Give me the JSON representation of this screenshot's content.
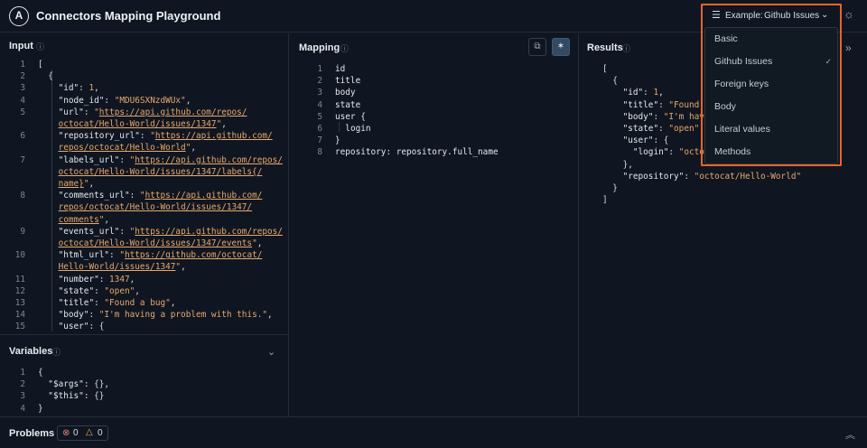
{
  "header": {
    "logo_letter": "A",
    "title": "Connectors Mapping Playground",
    "example_label": "Example:",
    "example_value": "Github Issues",
    "list_icon": "list-icon",
    "chevron_icon": "chevron-down-icon",
    "theme_icon": "sun-icon"
  },
  "input": {
    "title": "Input",
    "lines": [
      {
        "n": "1",
        "html": "<span class='p'>[</span>"
      },
      {
        "n": "2",
        "html": "  <span class='p'>{</span>"
      },
      {
        "n": "3",
        "html": "    <span class='k'>\"id\"</span><span class='p'>: </span><span class='n'>1</span><span class='p'>,</span>"
      },
      {
        "n": "4",
        "html": "    <span class='k'>\"node_id\"</span><span class='p'>: </span><span class='s'>\"MDU6SXNzdWUx\"</span><span class='p'>,</span>"
      },
      {
        "n": "5",
        "html": "    <span class='k'>\"url\"</span><span class='p'>: </span><span class='s'>\"</span><span class='u'>https://api.github.com/repos/</span>"
      },
      {
        "n": "",
        "html": "    <span class='u'>octocat/Hello-World/issues/1347</span><span class='s'>\"</span><span class='p'>,</span>"
      },
      {
        "n": "6",
        "html": "    <span class='k'>\"repository_url\"</span><span class='p'>: </span><span class='s'>\"</span><span class='u'>https://api.github.com/</span>"
      },
      {
        "n": "",
        "html": "    <span class='u'>repos/octocat/Hello-World</span><span class='s'>\"</span><span class='p'>,</span>"
      },
      {
        "n": "7",
        "html": "    <span class='k'>\"labels_url\"</span><span class='p'>: </span><span class='s'>\"</span><span class='u'>https://api.github.com/repos/</span>"
      },
      {
        "n": "",
        "html": "    <span class='u'>octocat/Hello-World/issues/1347/labels{/</span>"
      },
      {
        "n": "",
        "html": "    <span class='u'>name}</span><span class='s'>\"</span><span class='p'>,</span>"
      },
      {
        "n": "8",
        "html": "    <span class='k'>\"comments_url\"</span><span class='p'>: </span><span class='s'>\"</span><span class='u'>https://api.github.com/</span>"
      },
      {
        "n": "",
        "html": "    <span class='u'>repos/octocat/Hello-World/issues/1347/</span>"
      },
      {
        "n": "",
        "html": "    <span class='u'>comments</span><span class='s'>\"</span><span class='p'>,</span>"
      },
      {
        "n": "9",
        "html": "    <span class='k'>\"events_url\"</span><span class='p'>: </span><span class='s'>\"</span><span class='u'>https://api.github.com/repos/</span>"
      },
      {
        "n": "",
        "html": "    <span class='u'>octocat/Hello-World/issues/1347/events</span><span class='s'>\"</span><span class='p'>,</span>"
      },
      {
        "n": "10",
        "html": "    <span class='k'>\"html_url\"</span><span class='p'>: </span><span class='s'>\"</span><span class='u'>https://github.com/octocat/</span>"
      },
      {
        "n": "",
        "html": "    <span class='u'>Hello-World/issues/1347</span><span class='s'>\"</span><span class='p'>,</span>"
      },
      {
        "n": "11",
        "html": "    <span class='k'>\"number\"</span><span class='p'>: </span><span class='n'>1347</span><span class='p'>,</span>"
      },
      {
        "n": "12",
        "html": "    <span class='k'>\"state\"</span><span class='p'>: </span><span class='s'>\"open\"</span><span class='p'>,</span>"
      },
      {
        "n": "13",
        "html": "    <span class='k'>\"title\"</span><span class='p'>: </span><span class='s'>\"Found a bug\"</span><span class='p'>,</span>"
      },
      {
        "n": "14",
        "html": "    <span class='k'>\"body\"</span><span class='p'>: </span><span class='s'>\"I'm having a problem with this.\"</span><span class='p'>,</span>"
      },
      {
        "n": "15",
        "html": "    <span class='k'>\"user\"</span><span class='p'>: {</span>"
      }
    ]
  },
  "variables": {
    "title": "Variables",
    "lines": [
      {
        "n": "1",
        "html": "<span class='p'>{</span>"
      },
      {
        "n": "2",
        "html": "  <span class='k'>\"$args\"</span><span class='p'>: {},</span>"
      },
      {
        "n": "3",
        "html": "  <span class='k'>\"$this\"</span><span class='p'>: {}</span>"
      },
      {
        "n": "4",
        "html": "<span class='p'>}</span>"
      }
    ]
  },
  "mapping": {
    "title": "Mapping",
    "lines": [
      {
        "n": "1",
        "html": "<span class='k'>id</span>"
      },
      {
        "n": "2",
        "html": "<span class='k'>title</span>"
      },
      {
        "n": "3",
        "html": "<span class='k'>body</span>"
      },
      {
        "n": "4",
        "html": "<span class='k'>state</span>"
      },
      {
        "n": "5",
        "html": "<span class='k'>user {</span>"
      },
      {
        "n": "6",
        "html": "  <span class='k'>login</span>"
      },
      {
        "n": "7",
        "html": "<span class='k'>}</span>"
      },
      {
        "n": "8",
        "html": "<span class='k'>repository: repository.full_name</span>"
      }
    ]
  },
  "results": {
    "title": "Results",
    "lines": [
      {
        "n": "",
        "html": "<span class='p'>[</span>"
      },
      {
        "n": "",
        "html": "  <span class='p'>{</span>"
      },
      {
        "n": "",
        "html": "    <span class='k'>\"id\"</span><span class='p'>: </span><span class='n'>1</span><span class='p'>,</span>"
      },
      {
        "n": "",
        "html": "    <span class='k'>\"title\"</span><span class='p'>: </span><span class='s'>\"Found a bug\"</span><span class='p'>,</span>"
      },
      {
        "n": "",
        "html": "    <span class='k'>\"body\"</span><span class='p'>: </span><span class='s'>\"I'm having a problem with this.\"</span><span class='p'>,</span>"
      },
      {
        "n": "",
        "html": "    <span class='k'>\"state\"</span><span class='p'>: </span><span class='s'>\"open\"</span><span class='p'>,</span>"
      },
      {
        "n": "",
        "html": "    <span class='k'>\"user\"</span><span class='p'>: {</span>"
      },
      {
        "n": "",
        "html": "      <span class='k'>\"login\"</span><span class='p'>: </span><span class='s'>\"octocat\"</span>"
      },
      {
        "n": "",
        "html": "    <span class='p'>},</span>"
      },
      {
        "n": "",
        "html": "    <span class='k'>\"repository\"</span><span class='p'>: </span><span class='s'>\"octocat/Hello-World\"</span>"
      },
      {
        "n": "",
        "html": "  <span class='p'>}</span>"
      },
      {
        "n": "",
        "html": "<span class='p'>]</span>"
      }
    ]
  },
  "problems": {
    "title": "Problems",
    "errors": "0",
    "warnings": "0"
  },
  "dropdown": {
    "items": [
      {
        "label": "Basic",
        "selected": false
      },
      {
        "label": "Github Issues",
        "selected": true
      },
      {
        "label": "Foreign keys",
        "selected": false
      },
      {
        "label": "Body",
        "selected": false
      },
      {
        "label": "Literal values",
        "selected": false
      },
      {
        "label": "Methods",
        "selected": false
      }
    ],
    "check_glyph": "✓"
  },
  "colors": {
    "background": "#0f1621",
    "border": "#232c38",
    "string": "#e7a86c",
    "highlight": "#e8642c"
  }
}
